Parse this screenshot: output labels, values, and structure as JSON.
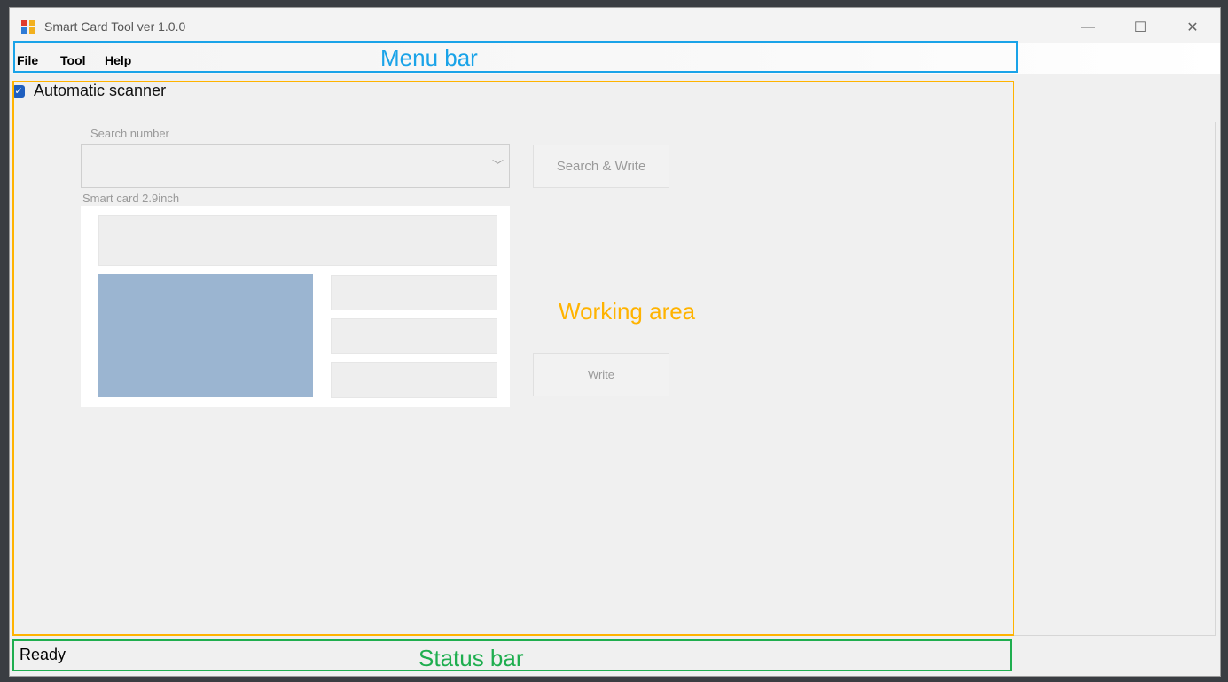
{
  "window": {
    "title": "Smart Card Tool ver 1.0.0",
    "controls": {
      "minimize": "—",
      "maximize": "☐",
      "close": "✕"
    }
  },
  "menu": {
    "items": [
      "File",
      "Tool",
      "Help"
    ]
  },
  "options": {
    "automatic_scanner": {
      "label": "Automatic scanner",
      "checked": true
    }
  },
  "search": {
    "label": "Search number",
    "value": "",
    "button": "Search & Write"
  },
  "card": {
    "label": "Smart card 2.9inch",
    "write_button": "Write"
  },
  "status": {
    "text": "Ready"
  },
  "annotations": {
    "menu_bar": "Menu bar",
    "working_area": "Working area",
    "status_bar": "Status bar"
  },
  "colors": {
    "menu_annotation": "#1aa3e8",
    "working_annotation": "#ffb300",
    "status_annotation": "#1fae4f",
    "checkbox": "#1f5fbf",
    "photo_placeholder": "#9bb5d1"
  }
}
